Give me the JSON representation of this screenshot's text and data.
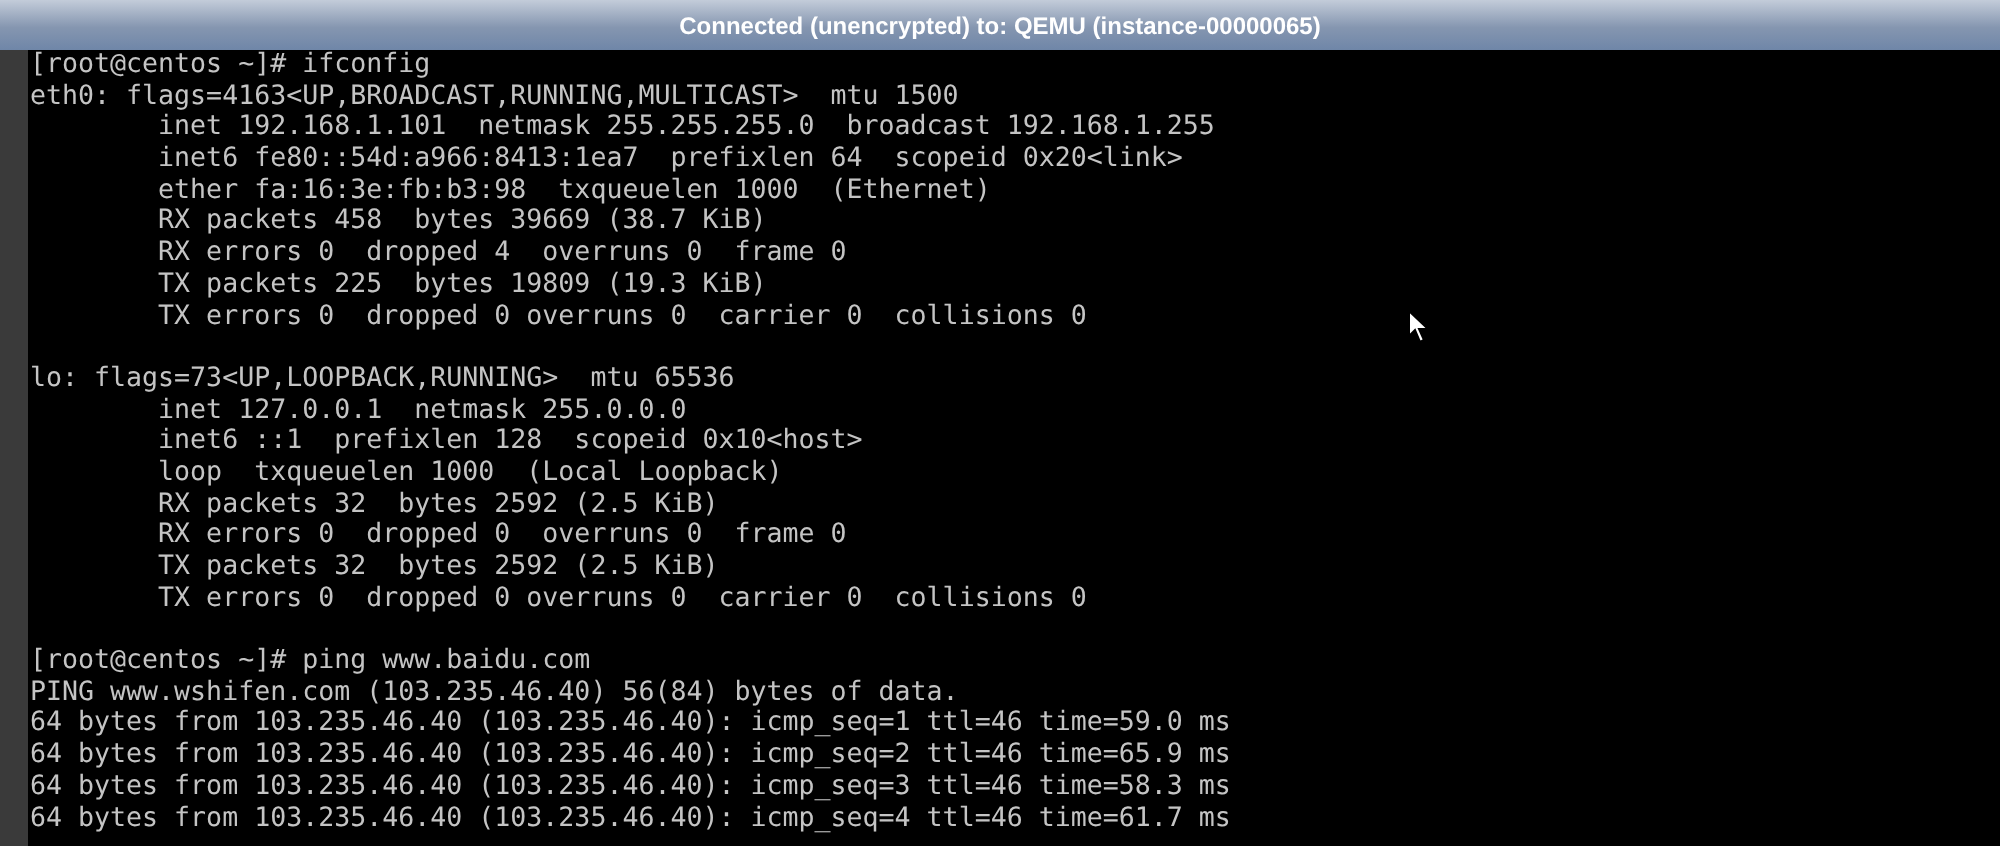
{
  "window": {
    "title": "Connected (unencrypted) to: QEMU (instance-00000065)"
  },
  "terminal": {
    "blocks": [
      [
        "[root@centos ~]# ifconfig",
        "eth0: flags=4163<UP,BROADCAST,RUNNING,MULTICAST>  mtu 1500",
        "        inet 192.168.1.101  netmask 255.255.255.0  broadcast 192.168.1.255",
        "        inet6 fe80::54d:a966:8413:1ea7  prefixlen 64  scopeid 0x20<link>",
        "        ether fa:16:3e:fb:b3:98  txqueuelen 1000  (Ethernet)",
        "        RX packets 458  bytes 39669 (38.7 KiB)",
        "        RX errors 0  dropped 4  overruns 0  frame 0",
        "        TX packets 225  bytes 19809 (19.3 KiB)",
        "        TX errors 0  dropped 0 overruns 0  carrier 0  collisions 0"
      ],
      [
        "lo: flags=73<UP,LOOPBACK,RUNNING>  mtu 65536",
        "        inet 127.0.0.1  netmask 255.0.0.0",
        "        inet6 ::1  prefixlen 128  scopeid 0x10<host>",
        "        loop  txqueuelen 1000  (Local Loopback)",
        "        RX packets 32  bytes 2592 (2.5 KiB)",
        "        RX errors 0  dropped 0  overruns 0  frame 0",
        "        TX packets 32  bytes 2592 (2.5 KiB)",
        "        TX errors 0  dropped 0 overruns 0  carrier 0  collisions 0"
      ],
      [
        "[root@centos ~]# ping www.baidu.com",
        "PING www.wshifen.com (103.235.46.40) 56(84) bytes of data.",
        "64 bytes from 103.235.46.40 (103.235.46.40): icmp_seq=1 ttl=46 time=59.0 ms",
        "64 bytes from 103.235.46.40 (103.235.46.40): icmp_seq=2 ttl=46 time=65.9 ms",
        "64 bytes from 103.235.46.40 (103.235.46.40): icmp_seq=3 ttl=46 time=58.3 ms",
        "64 bytes from 103.235.46.40 (103.235.46.40): icmp_seq=4 ttl=46 time=61.7 ms"
      ]
    ]
  }
}
